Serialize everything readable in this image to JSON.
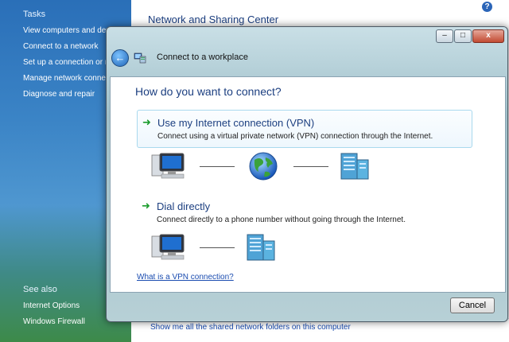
{
  "background": {
    "title": "Network and Sharing Center",
    "tasks_header": "Tasks",
    "tasks": [
      "View computers and dev",
      "Connect to a network",
      "Set up a connection or n",
      "Manage network connec",
      "Diagnose and repair"
    ],
    "see_also_header": "See also",
    "see_also": [
      "Internet Options",
      "Windows Firewall"
    ],
    "shared_link": "Show me all the shared network folders on this computer",
    "help_glyph": "?"
  },
  "dialog": {
    "title": "Connect to a workplace",
    "question": "How do you want to connect?",
    "caption_buttons": {
      "minimize": "–",
      "maximize": "□",
      "close": "x"
    },
    "options": [
      {
        "title": "Use my Internet connection (VPN)",
        "description": "Connect using a virtual private network (VPN) connection through the Internet."
      },
      {
        "title": "Dial directly",
        "description": "Connect directly to a phone number without going through the Internet."
      }
    ],
    "vpn_link": "What is a VPN connection?",
    "cancel_label": "Cancel"
  },
  "colors": {
    "accent_blue": "#1c3f80",
    "link_blue": "#1a4cb0",
    "arrow_green": "#1b9c2c",
    "option_hover_border": "#a9d9ee"
  },
  "icons": [
    "back-arrow-icon",
    "wizard-network-icon",
    "computer-icon",
    "globe-icon",
    "server-icon",
    "help-icon"
  ]
}
